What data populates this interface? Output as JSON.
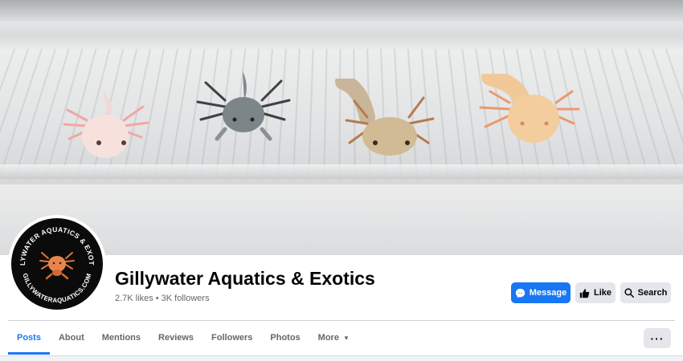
{
  "page": {
    "name": "Gillywater Aquatics & Exotics",
    "stats": "2.7K likes • 3K followers"
  },
  "avatar": {
    "ring_text_top": "GILLYWATER AQUATICS & EXOTICS",
    "ring_text_bottom": "GILLYWATERAQUATICS.COM"
  },
  "actions": {
    "message_label": "Message",
    "like_label": "Like",
    "search_label": "Search"
  },
  "tabs": [
    {
      "label": "Posts",
      "active": true
    },
    {
      "label": "About"
    },
    {
      "label": "Mentions"
    },
    {
      "label": "Reviews"
    },
    {
      "label": "Followers"
    },
    {
      "label": "Photos"
    },
    {
      "label": "More"
    }
  ],
  "more_menu_label": "···",
  "colors": {
    "accent": "#1877f2",
    "button_gray": "#e4e6eb",
    "text_primary": "#050505",
    "text_secondary": "#65676b"
  },
  "icons": [
    "messenger-icon",
    "thumbs-up-icon",
    "search-icon",
    "caret-down-icon",
    "more-dots-icon"
  ]
}
